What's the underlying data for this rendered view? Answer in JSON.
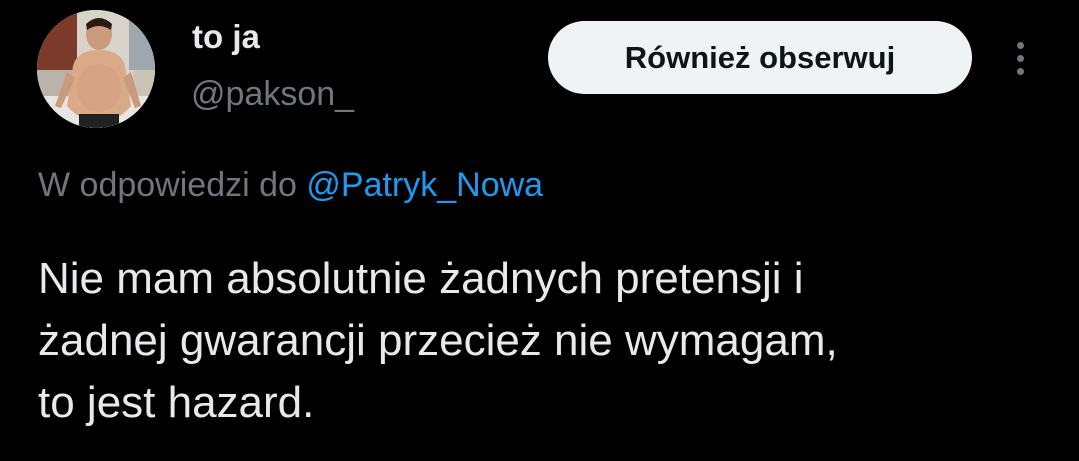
{
  "author": {
    "display_name": "to ja",
    "handle": "@pakson_",
    "avatar_icon": "profile-photo"
  },
  "header": {
    "follow_label": "Również obserwuj",
    "more_icon": "more-vertical-icon"
  },
  "reply": {
    "prefix": "W odpowiedzi do",
    "mention": "@Patryk_Nowa"
  },
  "tweet": {
    "lines": [
      "Nie mam absolutnie żadnych pretensji i",
      "żadnej gwarancji przecież nie wymagam,",
      "to jest hazard."
    ]
  },
  "colors": {
    "background": "#000000",
    "primary_text": "#e7e9ea",
    "secondary_text": "#71767b",
    "link": "#1d9bf0",
    "button_bg": "#eff3f4",
    "button_text": "#0f1419"
  }
}
